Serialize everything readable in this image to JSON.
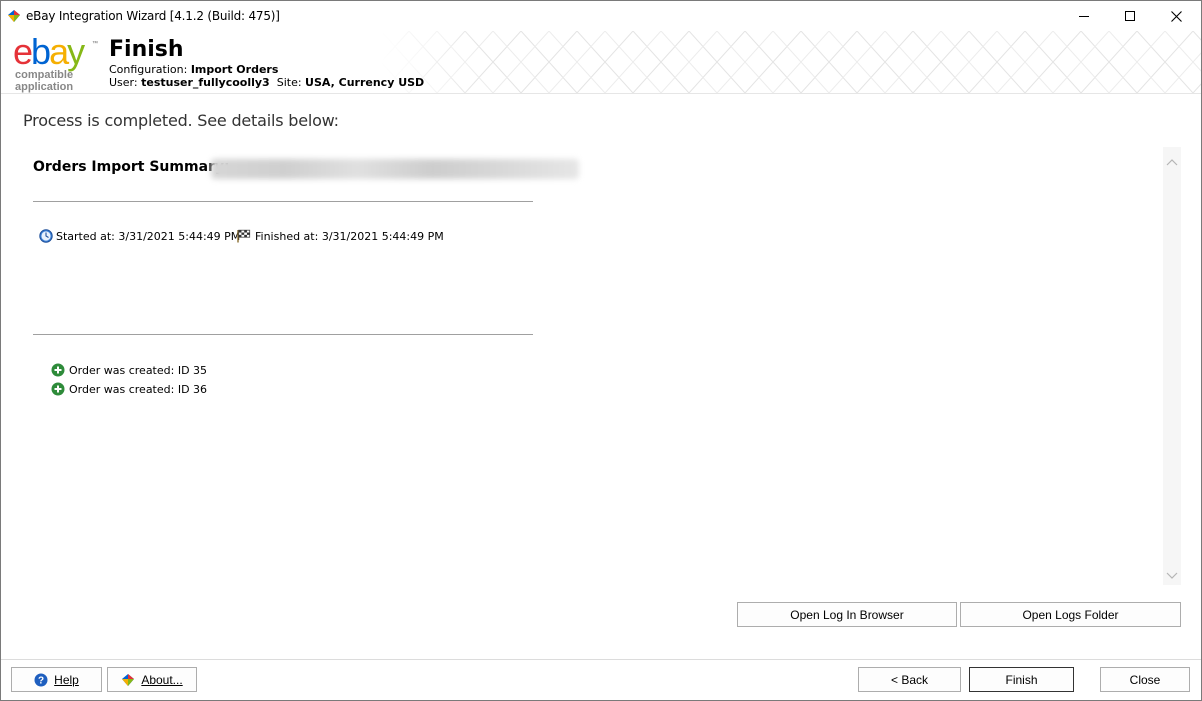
{
  "window": {
    "title": "eBay Integration Wizard [4.1.2 (Build: 475)]"
  },
  "header": {
    "logo_text": "ebay",
    "logo_tag": "compatible application",
    "page_title": "Finish",
    "config_label": "Configuration:",
    "config_value": "Import Orders",
    "user_label": "User:",
    "user_value": "testuser_fullycoolly3",
    "site_label": "Site:",
    "site_value": "USA, Currency USD"
  },
  "status": {
    "message": "Process is completed. See details below:"
  },
  "report": {
    "summary_title": "Orders Import Summary:",
    "started": "Started at: 3/31/2021 5:44:49 PM",
    "finished": "Finished at: 3/31/2021 5:44:49 PM",
    "orders": [
      "Order was created: ID 35",
      "Order was created: ID 36"
    ]
  },
  "actions": {
    "open_log_browser": "Open Log In Browser",
    "open_logs_folder": "Open Logs Folder"
  },
  "footer": {
    "help": "Help",
    "about": "About...",
    "back": "< Back",
    "finish": "Finish",
    "close": "Close"
  },
  "colors": {
    "ebay_e": "#e53238",
    "ebay_b": "#0064d2",
    "ebay_a": "#f5af02",
    "ebay_y": "#86b817",
    "order_icon": "#2e8b3a"
  }
}
